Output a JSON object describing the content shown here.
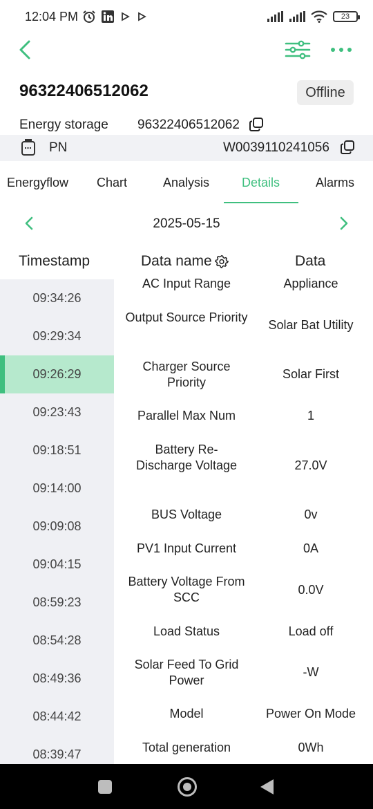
{
  "status_bar": {
    "time": "12:04 PM",
    "battery": "23",
    "left_icons": [
      "alarm-icon",
      "linkedin-icon",
      "play-icon",
      "play-icon"
    ],
    "right_icons": [
      "signal-icon",
      "signal-icon",
      "wifi-icon",
      "battery-icon"
    ]
  },
  "colors": {
    "accent": "#3fbf7f",
    "selected_row": "#b6e9cd",
    "panel_bg": "#eff0f4"
  },
  "device": {
    "id": "96322406512062",
    "status": "Offline",
    "type_label": "Energy storage",
    "type_value": "96322406512062",
    "pn_label": "PN",
    "pn_value": "W0039110241056"
  },
  "tabs": [
    {
      "label": "Energyflow",
      "active": false
    },
    {
      "label": "Chart",
      "active": false
    },
    {
      "label": "Analysis",
      "active": false
    },
    {
      "label": "Details",
      "active": true
    },
    {
      "label": "Alarms",
      "active": false
    }
  ],
  "date": "2025-05-15",
  "table": {
    "headers": {
      "timestamp": "Timestamp",
      "name": "Data name",
      "data": "Data"
    },
    "timestamps": [
      "09:34:26",
      "09:29:34",
      "09:26:29",
      "09:23:43",
      "09:18:51",
      "09:14:00",
      "09:09:08",
      "09:04:15",
      "08:59:23",
      "08:54:28",
      "08:49:36",
      "08:44:42",
      "08:39:47"
    ],
    "selected_timestamp": "09:26:29",
    "rows": [
      {
        "name": "AC Input Range",
        "value": "Appliance"
      },
      {
        "name": "Output Source Priority",
        "value": "Solar Bat Utility"
      },
      {
        "name": "Charger Source Priority",
        "value": "Solar First"
      },
      {
        "name": "Parallel Max Num",
        "value": "1"
      },
      {
        "name": "Battery Re-Discharge Voltage",
        "value": "27.0V"
      },
      {
        "name": "BUS Voltage",
        "value": "0v"
      },
      {
        "name": "PV1 Input Current",
        "value": "0A"
      },
      {
        "name": "Battery Voltage From SCC",
        "value": "0.0V"
      },
      {
        "name": "Load Status",
        "value": "Load off"
      },
      {
        "name": "Solar Feed To Grid Power",
        "value": "-W"
      },
      {
        "name": "Model",
        "value": "Power On Mode"
      },
      {
        "name": "Total generation",
        "value": "0Wh"
      }
    ]
  }
}
